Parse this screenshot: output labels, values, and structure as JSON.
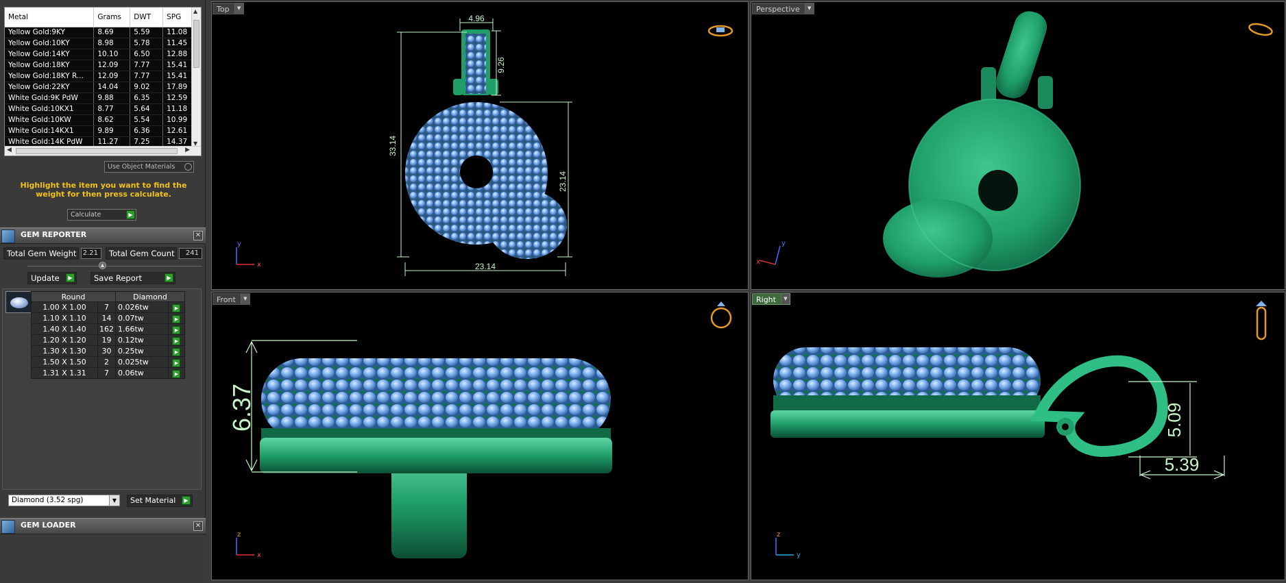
{
  "metal_table": {
    "headers": [
      "Metal",
      "Grams",
      "DWT",
      "SPG"
    ],
    "rows": [
      [
        "Yellow Gold:9KY",
        "8.69",
        "5.59",
        "11.08"
      ],
      [
        "Yellow Gold:10KY",
        "8.98",
        "5.78",
        "11.45"
      ],
      [
        "Yellow Gold:14KY",
        "10.10",
        "6.50",
        "12.88"
      ],
      [
        "Yellow Gold:18KY",
        "12.09",
        "7.77",
        "15.41"
      ],
      [
        "Yellow Gold:18KY R...",
        "12.09",
        "7.77",
        "15.41"
      ],
      [
        "Yellow Gold:22KY",
        "14.04",
        "9.02",
        "17.89"
      ],
      [
        "White Gold:9K PdW",
        "9.88",
        "6.35",
        "12.59"
      ],
      [
        "White Gold:10KX1",
        "8.77",
        "5.64",
        "11.18"
      ],
      [
        "White Gold:10KW",
        "8.62",
        "5.54",
        "10.99"
      ],
      [
        "White Gold:14KX1",
        "9.89",
        "6.36",
        "12.61"
      ],
      [
        "White Gold:14K PdW",
        "11.27",
        "7.25",
        "14.37"
      ]
    ]
  },
  "use_object_materials": "Use Object Materials",
  "hint": "Highlight the item you want to find the weight for then press calculate.",
  "calculate_label": "Calculate",
  "gem_reporter": {
    "title": "GEM REPORTER",
    "total_weight_label": "Total Gem Weight",
    "total_weight": "2.21",
    "total_count_label": "Total Gem Count",
    "total_count": "241",
    "update_label": "Update",
    "save_label": "Save Report",
    "col_shape": "Round",
    "col_material": "Diamond",
    "rows": [
      {
        "size": "1.00 X 1.00",
        "count": "7",
        "weight": "0.026tw"
      },
      {
        "size": "1.10 X 1.10",
        "count": "14",
        "weight": "0.07tw"
      },
      {
        "size": "1.40 X 1.40",
        "count": "162",
        "weight": "1.66tw"
      },
      {
        "size": "1.20 X 1.20",
        "count": "19",
        "weight": "0.12tw"
      },
      {
        "size": "1.30 X 1.30",
        "count": "30",
        "weight": "0.25tw"
      },
      {
        "size": "1.50 X 1.50",
        "count": "2",
        "weight": "0.025tw"
      },
      {
        "size": "1.31 X 1.31",
        "count": "7",
        "weight": "0.06tw"
      }
    ],
    "material_select": "Diamond   (3.52 spg)",
    "set_material_label": "Set Material"
  },
  "gem_loader": {
    "title": "GEM LOADER"
  },
  "viewports": {
    "top": {
      "label": "Top",
      "dims": [
        "4.96",
        "9.26",
        "33.14",
        "23.14",
        "23.14"
      ]
    },
    "perspective": {
      "label": "Perspective"
    },
    "front": {
      "label": "Front",
      "dims": [
        "6.37"
      ]
    },
    "right": {
      "label": "Right",
      "dims": [
        "5.09",
        "5.39"
      ]
    }
  },
  "axes": {
    "x": "x",
    "y": "y",
    "z": "z"
  },
  "colors": {
    "metal": "#1f9e6a",
    "gem": "#7fb2ef",
    "dimension": "#c8f5c8",
    "hint": "#f2c21b",
    "go": "#2f9d2f"
  }
}
